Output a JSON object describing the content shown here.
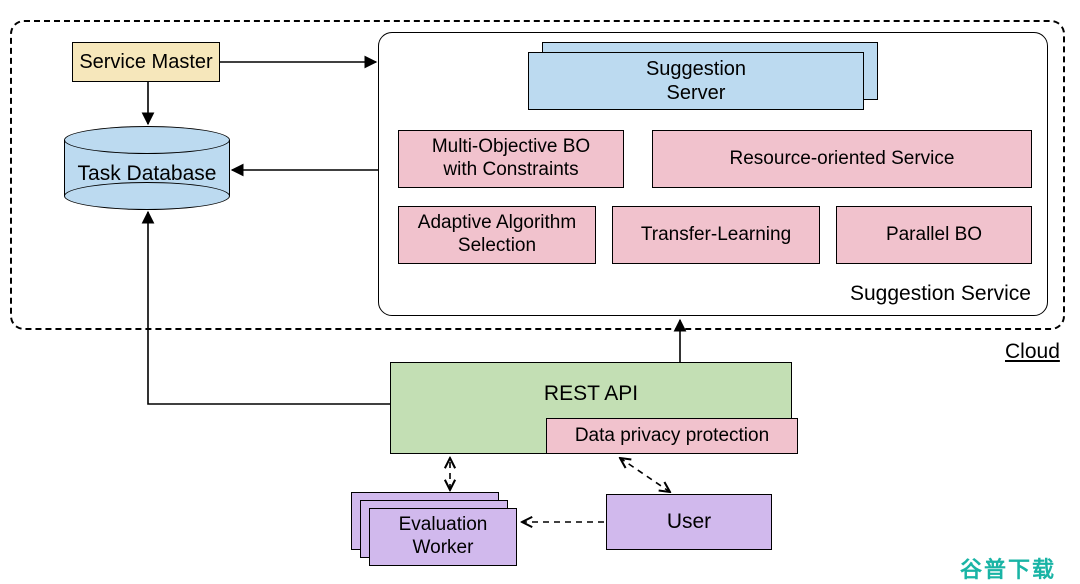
{
  "diagram": {
    "cloud_label": "Cloud",
    "service_master": "Service Master",
    "task_database": "Task Database",
    "suggestion_service_label": "Suggestion Service",
    "suggestion_server": "Suggestion\nServer",
    "features": {
      "multi_objective": "Multi-Objective BO\nwith Constraints",
      "resource_service": "Resource-oriented Service",
      "adaptive_selection": "Adaptive Algorithm\nSelection",
      "transfer_learning": "Transfer-Learning",
      "parallel_bo": "Parallel BO"
    },
    "rest_api": "REST API",
    "data_privacy": "Data privacy protection",
    "evaluation_worker": "Evaluation\nWorker",
    "user": "User",
    "watermark": "谷普下载"
  },
  "colors": {
    "yellow": "#f6e7bb",
    "blue": "#bcdaf0",
    "pink": "#f1c2cd",
    "green": "#c3dfb4",
    "purple": "#d1b9ed"
  }
}
